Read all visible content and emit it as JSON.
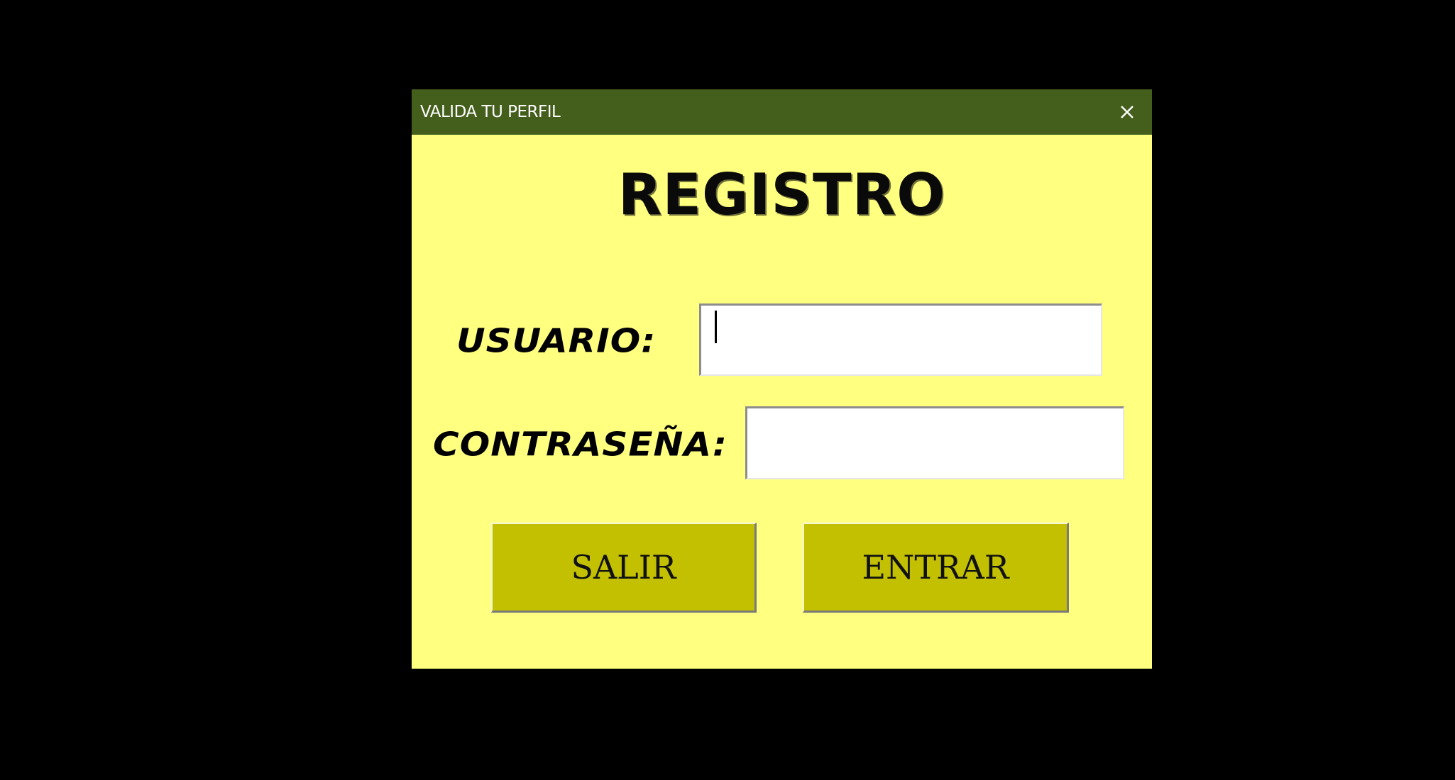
{
  "window": {
    "title": "VALIDA TU PERFIL",
    "close_icon": "close-icon"
  },
  "form": {
    "heading": "REGISTRO",
    "user_label": "USUARIO:",
    "user_value": "",
    "password_label": "CONTRASEÑA:",
    "password_value": ""
  },
  "buttons": {
    "exit_label": "SALIR",
    "enter_label": "ENTRAR"
  },
  "colors": {
    "titlebar": "#445e1c",
    "dialog_background": "#ffff80",
    "button_background": "#c2c000",
    "page_background": "#000000"
  }
}
